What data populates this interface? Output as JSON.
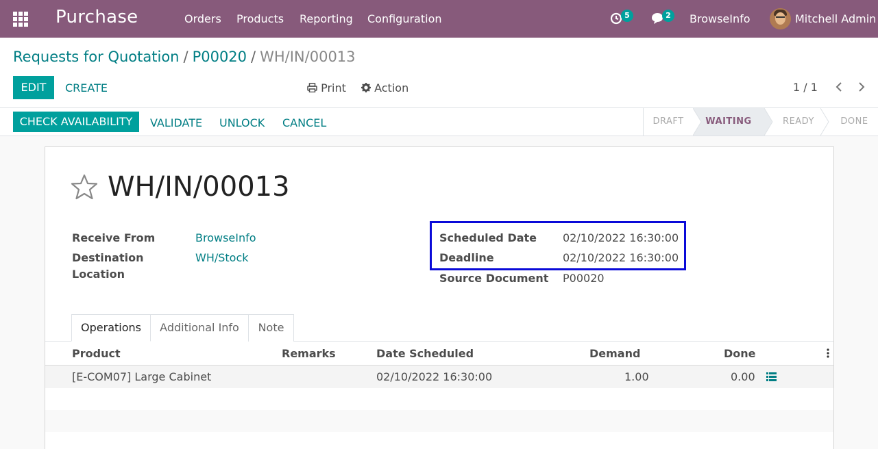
{
  "navbar": {
    "app_name": "Purchase",
    "menu": [
      "Orders",
      "Products",
      "Reporting",
      "Configuration"
    ],
    "activity_count": "5",
    "message_count": "2",
    "company": "BrowseInfo",
    "user": "Mitchell Admin",
    "bg_color": "#875a7b"
  },
  "breadcrumb": {
    "level1": "Requests for Quotation",
    "level2": "P00020",
    "current": "WH/IN/00013",
    "separator": "/"
  },
  "toolbar": {
    "edit_label": "EDIT",
    "create_label": "CREATE",
    "print_label": "Print",
    "action_label": "Action",
    "pager": "1 / 1"
  },
  "statusbar": {
    "buttons": [
      "CHECK AVAILABILITY",
      "VALIDATE",
      "UNLOCK",
      "CANCEL"
    ],
    "stages": [
      "DRAFT",
      "WAITING",
      "READY",
      "DONE"
    ],
    "active_stage": "WAITING"
  },
  "record": {
    "title": "WH/IN/00013",
    "receive_from_label": "Receive From",
    "receive_from": "BrowseInfo",
    "destination_label_1": "Destination",
    "destination_label_2": "Location",
    "destination": "WH/Stock",
    "scheduled_date_label": "Scheduled Date",
    "scheduled_date": "02/10/2022 16:30:00",
    "deadline_label": "Deadline",
    "deadline": "02/10/2022 16:30:00",
    "source_document_label": "Source Document",
    "source_document": "P00020",
    "highlight_color": "#0a0ad8"
  },
  "tabs": [
    "Operations",
    "Additional Info",
    "Note"
  ],
  "operations": {
    "columns": [
      "Product",
      "Remarks",
      "Date Scheduled",
      "Demand",
      "Done"
    ],
    "rows": [
      {
        "product": "[E-COM07] Large Cabinet",
        "remarks": "",
        "date_scheduled": "02/10/2022 16:30:00",
        "demand": "1.00",
        "done": "0.00"
      }
    ]
  },
  "colors": {
    "primary": "#00a09d",
    "link": "#017e84"
  }
}
